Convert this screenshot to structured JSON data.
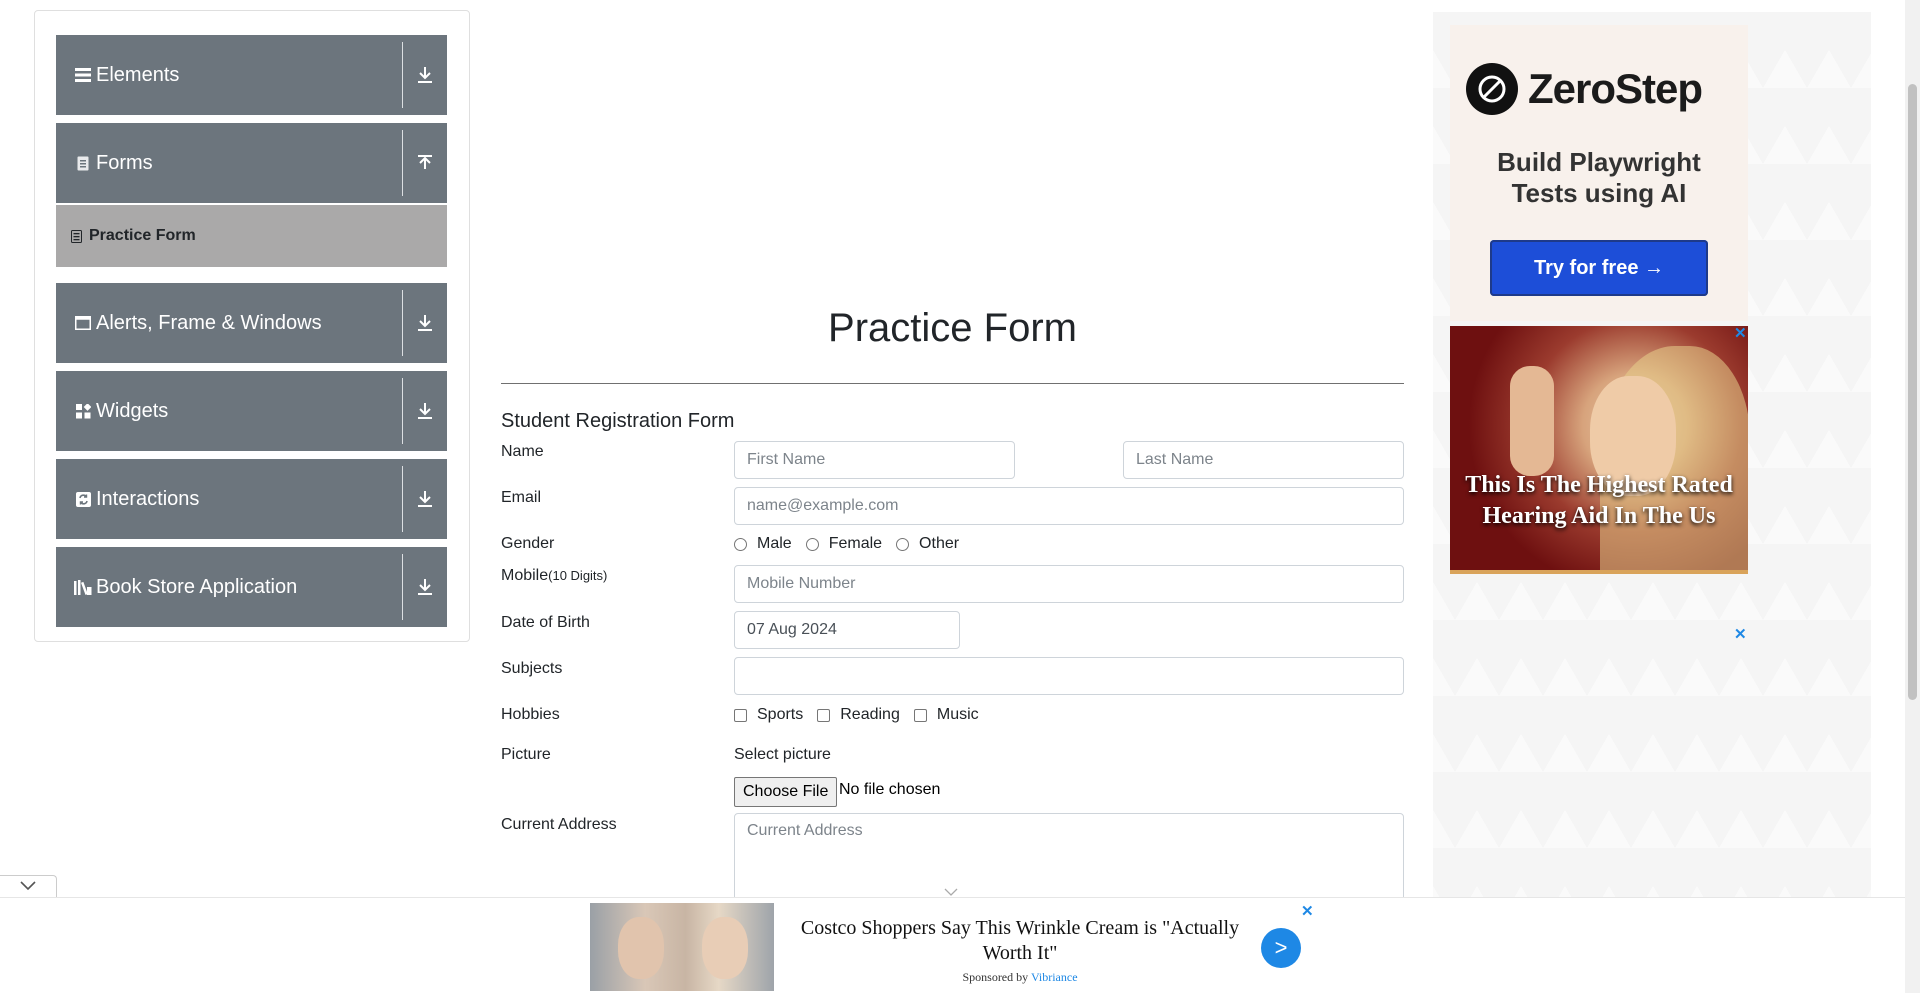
{
  "sidebar": {
    "groups": [
      {
        "label": "Elements",
        "icon": "list-icon"
      },
      {
        "label": "Forms",
        "icon": "document-icon"
      },
      {
        "label": "Alerts, Frame & Windows",
        "icon": "window-icon"
      },
      {
        "label": "Widgets",
        "icon": "widgets-icon"
      },
      {
        "label": "Interactions",
        "icon": "interaction-icon"
      },
      {
        "label": "Book Store Application",
        "icon": "books-icon"
      }
    ],
    "active_item": "Practice Form"
  },
  "main": {
    "title": "Practice Form",
    "form_title": "Student Registration Form",
    "labels": {
      "name": "Name",
      "email": "Email",
      "gender": "Gender",
      "mobile": "Mobile",
      "mobile_hint": "(10 Digits)",
      "dob": "Date of Birth",
      "subjects": "Subjects",
      "hobbies": "Hobbies",
      "picture": "Picture",
      "address": "Current Address"
    },
    "placeholders": {
      "first_name": "First Name",
      "last_name": "Last Name",
      "email": "name@example.com",
      "mobile": "Mobile Number",
      "address": "Current Address"
    },
    "dob_value": "07 Aug 2024",
    "gender_options": [
      "Male",
      "Female",
      "Other"
    ],
    "hobby_options": [
      "Sports",
      "Reading",
      "Music"
    ],
    "picture_prompt": "Select picture",
    "file_button": "Choose File",
    "file_status": "No file chosen"
  },
  "ads": {
    "zerostep": {
      "brand": "ZeroStep",
      "tagline_1": "Build Playwright",
      "tagline_2": "Tests using AI",
      "cta": "Try for free →"
    },
    "hearing": {
      "headline": "This Is The Highest Rated Hearing Aid In The Us"
    },
    "bottom": {
      "headline": "Costco Shoppers Say This Wrinkle Cream is \"Actually Worth It\"",
      "sponsored_prefix": "Sponsored by",
      "sponsor": "Vibriance",
      "go": ">"
    },
    "close_glyph": "✕"
  },
  "colors": {
    "sidebar_group_bg": "#6c757d",
    "active_item_bg": "#aaa9a9",
    "cta_blue": "#1d4ed8",
    "link_blue": "#1e88e5"
  }
}
